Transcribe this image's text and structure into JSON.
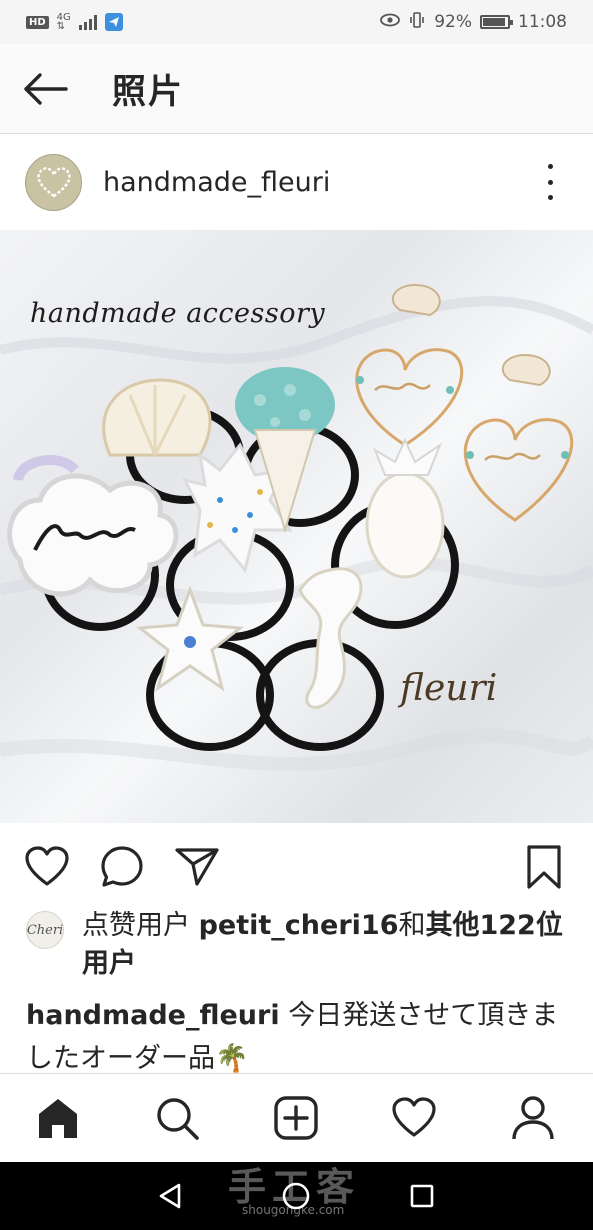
{
  "status_bar": {
    "hd": "HD",
    "network": "4G",
    "battery_text": "92%",
    "battery_level": 0.92,
    "time": "11:08"
  },
  "app_bar": {
    "title": "照片"
  },
  "post": {
    "username": "handmade_fleuri",
    "photo_text_1": "handmade  accessory",
    "photo_text_2": "fleuri"
  },
  "likes": {
    "avatar_text": "Cheri",
    "prefix": "点赞用户 ",
    "user": "petit_cheri16",
    "joiner": "和",
    "others": "其他122位用户"
  },
  "caption": {
    "username": "handmade_fleuri",
    "text": " 今日発送させて頂きましたオーダー品🌴"
  },
  "watermark": {
    "main": "手工客",
    "sub": "shougongke.com"
  },
  "icons": {
    "back": "arrow-left-icon",
    "more": "more-vertical-icon",
    "like": "heart-icon",
    "comment": "comment-icon",
    "share": "paper-plane-icon",
    "save": "bookmark-icon",
    "home": "home-icon",
    "search": "search-icon",
    "add": "add-post-icon",
    "activity": "heart-icon",
    "profile": "profile-icon"
  }
}
